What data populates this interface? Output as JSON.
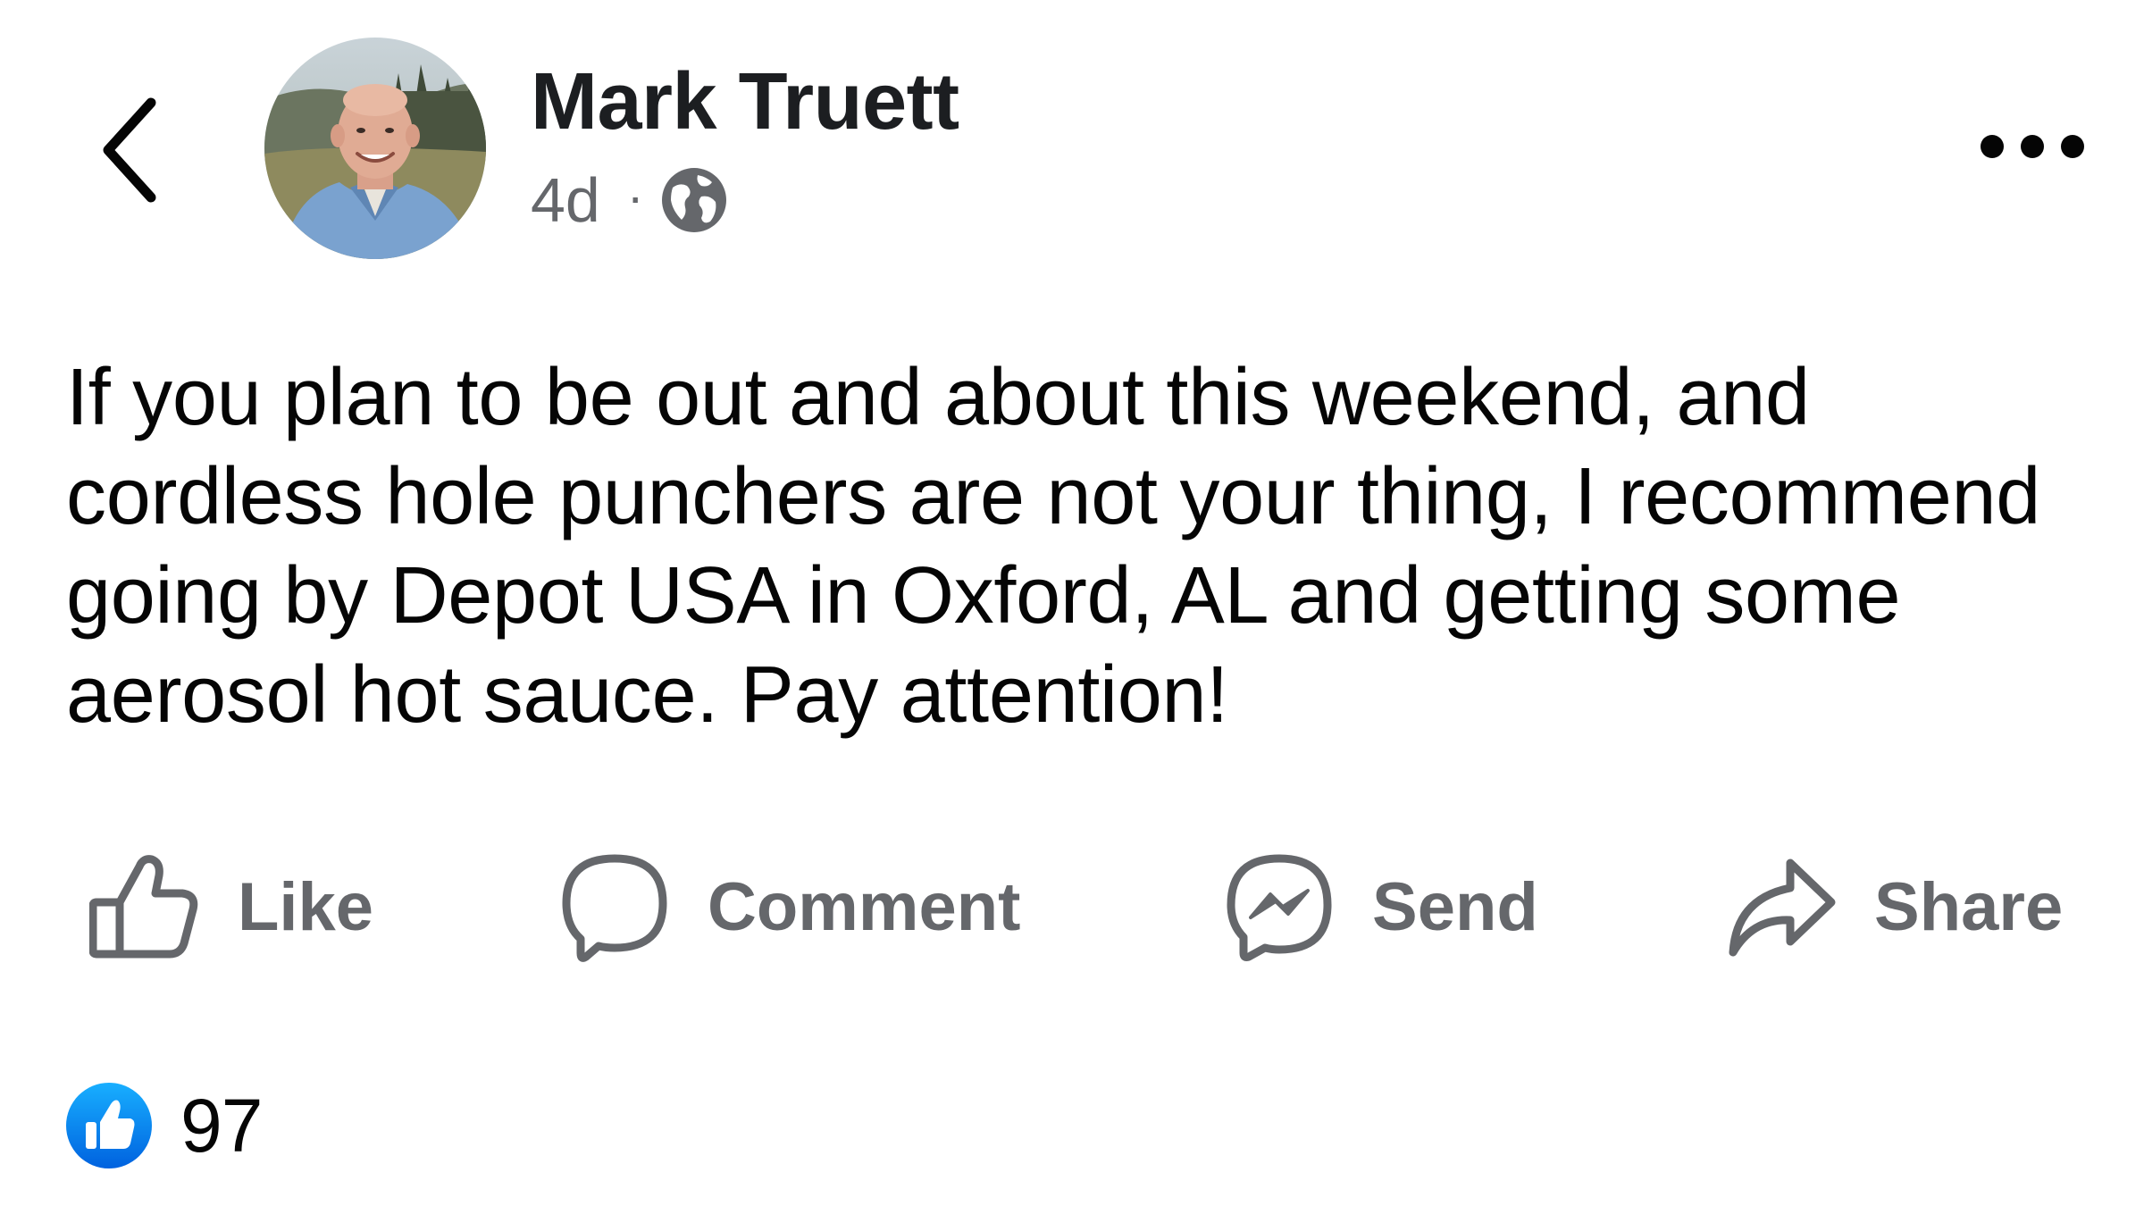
{
  "header": {
    "author_name": "Mark Truett",
    "timestamp": "4d",
    "separator": "·",
    "audience_icon": "globe-icon",
    "back_icon": "chevron-left-icon",
    "more_icon": "more-horizontal-icon"
  },
  "post": {
    "text": "If you plan to be out and about this weekend, and cordless hole punchers are not your thing, I recommend going by Depot USA in Oxford, AL and getting some aerosol hot sauce. Pay attention!"
  },
  "actions": {
    "like": {
      "label": "Like",
      "icon": "thumbs-up-icon"
    },
    "comment": {
      "label": "Comment",
      "icon": "comment-bubble-icon"
    },
    "send": {
      "label": "Send",
      "icon": "messenger-icon"
    },
    "share": {
      "label": "Share",
      "icon": "share-arrow-icon"
    }
  },
  "reactions": {
    "icon": "like-reaction-icon",
    "count": "97"
  },
  "colors": {
    "text_primary": "#050505",
    "text_secondary": "#65676b",
    "reaction_blue": "#1877f2"
  }
}
